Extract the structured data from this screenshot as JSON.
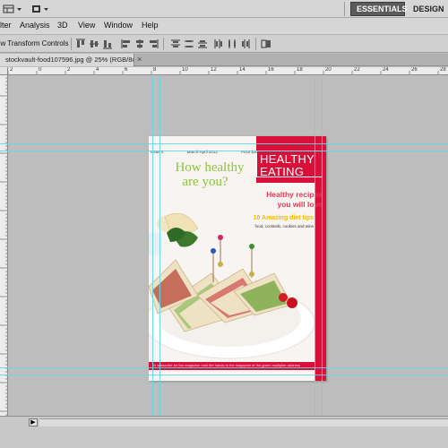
{
  "appbar": {
    "workspaces": [
      "ESSENTIALS",
      "DESIGN"
    ],
    "icons": [
      "layout-icon",
      "screen-mode-icon"
    ]
  },
  "menu": {
    "items": [
      "lter",
      "Analysis",
      "3D",
      "View",
      "Window",
      "Help"
    ]
  },
  "options": {
    "show_transform_controls": "ow Transform Controls",
    "align_icons": [
      "align-top-icon",
      "align-vcenter-icon",
      "align-bottom-icon",
      "align-left-icon",
      "align-hcenter-icon",
      "align-right-icon",
      "distribute-top-icon",
      "distribute-vcenter-icon",
      "distribute-bottom-icon",
      "distribute-left-icon",
      "distribute-hcenter-icon",
      "distribute-right-icon",
      "auto-align-icon"
    ]
  },
  "document": {
    "tab_title": "stockvault-food107596.jpg @ 25% (RGB/8#)",
    "close_glyph": "×"
  },
  "ruler": {
    "labels": [
      "2",
      "0",
      "2",
      "4",
      "6",
      "8",
      "10",
      "12",
      "14",
      "16",
      "18",
      "20",
      "22",
      "24",
      "26",
      "28"
    ]
  },
  "magazine": {
    "issue": "Issue 4",
    "date": "March-April 2012",
    "price": "Price $30",
    "masthead_line1": "HEALTHY",
    "masthead_line2": "EATING",
    "headline_line1": "How healthy",
    "headline_line2": "are you?",
    "sub_line1": "Healthy recipes",
    "sub_line2": "you will love",
    "tips_title": "10 Amazing diet tips",
    "tips_sub": "food, cocktails, cookies and wine",
    "footer": "To subscribe for the magazine mail the hands to the magazine at the green multiplier address"
  },
  "colors": {
    "accent_red": "#d8113a",
    "headline_green": "#8fc43a",
    "sub_pink": "#e33a55",
    "tips_yellow": "#f5b800",
    "guide_cyan": "#5fd8e6"
  },
  "status": {
    "arrow": "▶"
  }
}
